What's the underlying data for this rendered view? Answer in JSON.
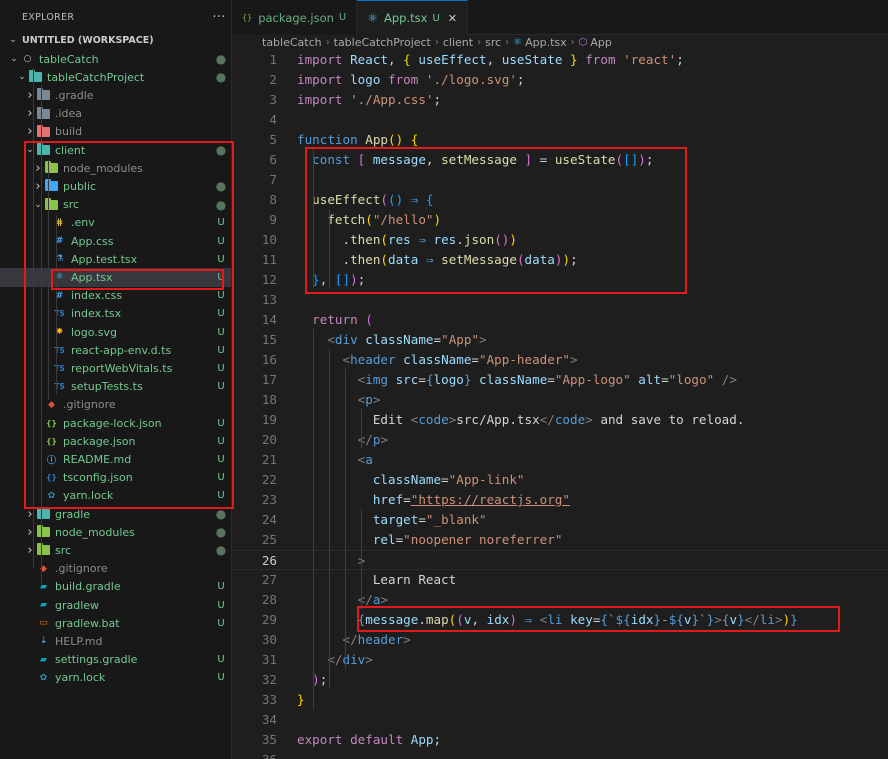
{
  "explorer": {
    "title": "EXPLORER",
    "more_label": "···",
    "workspace": "UNTITLED (WORKSPACE)",
    "items": [
      {
        "label": "tableCatch",
        "depth": 1,
        "chev": "v",
        "icon": "repo",
        "status": "dot",
        "cls": "c-git"
      },
      {
        "label": "tableCatchProject",
        "depth": 2,
        "chev": "v",
        "icon": "folder-teal",
        "status": "dot",
        "cls": "c-git"
      },
      {
        "label": ".gradle",
        "depth": 3,
        "chev": ">",
        "icon": "folder-gray",
        "status": "",
        "cls": "c-muted"
      },
      {
        "label": ".idea",
        "depth": 3,
        "chev": ">",
        "icon": "folder-gray",
        "status": "",
        "cls": "c-muted"
      },
      {
        "label": "build",
        "depth": 3,
        "chev": ">",
        "icon": "folder-red",
        "status": "",
        "cls": "c-muted"
      },
      {
        "label": "client",
        "depth": 3,
        "chev": "v",
        "icon": "folder-teal",
        "status": "dot",
        "cls": "c-git"
      },
      {
        "label": "node_modules",
        "depth": 4,
        "chev": ">",
        "icon": "folder-green",
        "status": "",
        "cls": "c-muted"
      },
      {
        "label": "public",
        "depth": 4,
        "chev": ">",
        "icon": "folder-blue",
        "status": "dot",
        "cls": "c-git"
      },
      {
        "label": "src",
        "depth": 4,
        "chev": "v",
        "icon": "folder-green",
        "status": "dot",
        "cls": "c-git"
      },
      {
        "label": ".env",
        "depth": 5,
        "chev": "",
        "icon": "env",
        "status": "U",
        "cls": "c-git"
      },
      {
        "label": "App.css",
        "depth": 5,
        "chev": "",
        "icon": "css",
        "status": "U",
        "cls": "c-git"
      },
      {
        "label": "App.test.tsx",
        "depth": 5,
        "chev": "",
        "icon": "test",
        "status": "U",
        "cls": "c-git"
      },
      {
        "label": "App.tsx",
        "depth": 5,
        "chev": "",
        "icon": "react",
        "status": "U",
        "cls": "c-git",
        "selected": true
      },
      {
        "label": "index.css",
        "depth": 5,
        "chev": "",
        "icon": "css",
        "status": "U",
        "cls": "c-git"
      },
      {
        "label": "index.tsx",
        "depth": 5,
        "chev": "",
        "icon": "ts",
        "status": "U",
        "cls": "c-git"
      },
      {
        "label": "logo.svg",
        "depth": 5,
        "chev": "",
        "icon": "svg",
        "status": "U",
        "cls": "c-git"
      },
      {
        "label": "react-app-env.d.ts",
        "depth": 5,
        "chev": "",
        "icon": "ts",
        "status": "U",
        "cls": "c-git"
      },
      {
        "label": "reportWebVitals.ts",
        "depth": 5,
        "chev": "",
        "icon": "ts",
        "status": "U",
        "cls": "c-git"
      },
      {
        "label": "setupTests.ts",
        "depth": 5,
        "chev": "",
        "icon": "ts",
        "status": "U",
        "cls": "c-git"
      },
      {
        "label": ".gitignore",
        "depth": 4,
        "chev": "",
        "icon": "git",
        "status": "",
        "cls": "c-muted"
      },
      {
        "label": "package-lock.json",
        "depth": 4,
        "chev": "",
        "icon": "json",
        "status": "U",
        "cls": "c-git"
      },
      {
        "label": "package.json",
        "depth": 4,
        "chev": "",
        "icon": "json",
        "status": "U",
        "cls": "c-git"
      },
      {
        "label": "README.md",
        "depth": 4,
        "chev": "",
        "icon": "info",
        "status": "U",
        "cls": "c-git"
      },
      {
        "label": "tsconfig.json",
        "depth": 4,
        "chev": "",
        "icon": "tsconfig",
        "status": "U",
        "cls": "c-git"
      },
      {
        "label": "yarn.lock",
        "depth": 4,
        "chev": "",
        "icon": "yarn",
        "status": "U",
        "cls": "c-git"
      },
      {
        "label": "gradle",
        "depth": 3,
        "chev": ">",
        "icon": "folder-teal",
        "status": "dot",
        "cls": "c-git"
      },
      {
        "label": "node_modules",
        "depth": 3,
        "chev": ">",
        "icon": "folder-green",
        "status": "dot",
        "cls": "c-git"
      },
      {
        "label": "src",
        "depth": 3,
        "chev": ">",
        "icon": "folder-green",
        "status": "dot",
        "cls": "c-git"
      },
      {
        "label": ".gitignore",
        "depth": 3,
        "chev": "",
        "icon": "git",
        "status": "",
        "cls": "c-muted"
      },
      {
        "label": "build.gradle",
        "depth": 3,
        "chev": "",
        "icon": "gradle",
        "status": "U",
        "cls": "c-git"
      },
      {
        "label": "gradlew",
        "depth": 3,
        "chev": "",
        "icon": "gradle",
        "status": "U",
        "cls": "c-git"
      },
      {
        "label": "gradlew.bat",
        "depth": 3,
        "chev": "",
        "icon": "bat",
        "status": "U",
        "cls": "c-git"
      },
      {
        "label": "HELP.md",
        "depth": 3,
        "chev": "",
        "icon": "md",
        "status": "",
        "cls": "c-muted"
      },
      {
        "label": "settings.gradle",
        "depth": 3,
        "chev": "",
        "icon": "gradle",
        "status": "U",
        "cls": "c-git"
      },
      {
        "label": "yarn.lock",
        "depth": 3,
        "chev": "",
        "icon": "yarn",
        "status": "U",
        "cls": "c-git"
      }
    ]
  },
  "tabs": [
    {
      "label": "package.json",
      "status": "U",
      "active": false,
      "icon": "json"
    },
    {
      "label": "App.tsx",
      "status": "U",
      "active": true,
      "icon": "react",
      "close": "✕"
    }
  ],
  "breadcrumb": [
    "tableCatch",
    "tableCatchProject",
    "client",
    "src",
    "App.tsx",
    "App"
  ],
  "colors": {
    "accent": "#0078d4",
    "git_untracked": "#73c991",
    "highlight_box": "#e11b1b"
  },
  "editor": {
    "current_line": 26,
    "lines": [
      [
        [
          "import ",
          "kw"
        ],
        [
          "React",
          "var"
        ],
        [
          ", ",
          "pn"
        ],
        [
          "{ ",
          "br1"
        ],
        [
          "useEffect",
          "var"
        ],
        [
          ", ",
          "pn"
        ],
        [
          "useState",
          "var"
        ],
        [
          " }",
          "br1"
        ],
        [
          " from ",
          "kw"
        ],
        [
          "'react'",
          "str"
        ],
        [
          ";",
          "pn"
        ]
      ],
      [
        [
          "import ",
          "kw"
        ],
        [
          "logo",
          "var"
        ],
        [
          " from ",
          "kw"
        ],
        [
          "'./logo.svg'",
          "str"
        ],
        [
          ";",
          "pn"
        ]
      ],
      [
        [
          "import ",
          "kw"
        ],
        [
          "'./App.css'",
          "str"
        ],
        [
          ";",
          "pn"
        ]
      ],
      [],
      [
        [
          "function ",
          "bl"
        ],
        [
          "App",
          "fn"
        ],
        [
          "() ",
          "br1"
        ],
        [
          "{",
          "br1"
        ]
      ],
      [
        [
          "  const ",
          "bl"
        ],
        [
          "[ ",
          "br2"
        ],
        [
          "message",
          "var"
        ],
        [
          ", ",
          "pn"
        ],
        [
          "setMessage",
          "fn"
        ],
        [
          " ]",
          "br2"
        ],
        [
          " = ",
          "pn"
        ],
        [
          "useState",
          "fn"
        ],
        [
          "(",
          "br2"
        ],
        [
          "[]",
          "br3"
        ],
        [
          ")",
          "br2"
        ],
        [
          ";",
          "pn"
        ]
      ],
      [],
      [
        [
          "  useEffect",
          "fn"
        ],
        [
          "(",
          "br2"
        ],
        [
          "() ",
          "br3"
        ],
        [
          "⇒ ",
          "bl"
        ],
        [
          "{",
          "br3"
        ]
      ],
      [
        [
          "    fetch",
          "fn"
        ],
        [
          "(",
          "br1"
        ],
        [
          "\"/hello\"",
          "str"
        ],
        [
          ")",
          "br1"
        ]
      ],
      [
        [
          "      .",
          "pn"
        ],
        [
          "then",
          "fn"
        ],
        [
          "(",
          "br1"
        ],
        [
          "res",
          "var"
        ],
        [
          " ⇒ ",
          "bl"
        ],
        [
          "res",
          "var"
        ],
        [
          ".",
          "pn"
        ],
        [
          "json",
          "fn"
        ],
        [
          "()",
          "br2"
        ],
        [
          ")",
          "br1"
        ]
      ],
      [
        [
          "      .",
          "pn"
        ],
        [
          "then",
          "fn"
        ],
        [
          "(",
          "br1"
        ],
        [
          "data",
          "var"
        ],
        [
          " ⇒ ",
          "bl"
        ],
        [
          "setMessage",
          "fn"
        ],
        [
          "(",
          "br2"
        ],
        [
          "data",
          "var"
        ],
        [
          ")",
          "br2"
        ],
        [
          ")",
          "br1"
        ],
        [
          ";",
          "pn"
        ]
      ],
      [
        [
          "  }",
          "br3"
        ],
        [
          ", ",
          "pn"
        ],
        [
          "[]",
          "br3"
        ],
        [
          ")",
          "br2"
        ],
        [
          ";",
          "pn"
        ]
      ],
      [],
      [
        [
          "  return ",
          "kw"
        ],
        [
          "(",
          "br2"
        ]
      ],
      [
        [
          "    <",
          "tagb"
        ],
        [
          "div ",
          "tag"
        ],
        [
          "className",
          "attr"
        ],
        [
          "=",
          "pn"
        ],
        [
          "\"App\"",
          "str"
        ],
        [
          ">",
          "tagb"
        ]
      ],
      [
        [
          "      <",
          "tagb"
        ],
        [
          "header ",
          "tag"
        ],
        [
          "className",
          "attr"
        ],
        [
          "=",
          "pn"
        ],
        [
          "\"App-header\"",
          "str"
        ],
        [
          ">",
          "tagb"
        ]
      ],
      [
        [
          "        <",
          "tagb"
        ],
        [
          "img ",
          "tag"
        ],
        [
          "src",
          "attr"
        ],
        [
          "=",
          "pn"
        ],
        [
          "{",
          "bl"
        ],
        [
          "logo",
          "var"
        ],
        [
          "}",
          "bl"
        ],
        [
          " className",
          "attr"
        ],
        [
          "=",
          "pn"
        ],
        [
          "\"App-logo\"",
          "str"
        ],
        [
          " alt",
          "attr"
        ],
        [
          "=",
          "pn"
        ],
        [
          "\"logo\"",
          "str"
        ],
        [
          " />",
          "tagb"
        ]
      ],
      [
        [
          "        <",
          "tagb"
        ],
        [
          "p",
          "tag"
        ],
        [
          ">",
          "tagb"
        ]
      ],
      [
        [
          "          Edit ",
          "pn"
        ],
        [
          "<",
          "tagb"
        ],
        [
          "code",
          "tag"
        ],
        [
          ">",
          "tagb"
        ],
        [
          "src/App.tsx",
          "pn"
        ],
        [
          "</",
          "tagb"
        ],
        [
          "code",
          "tag"
        ],
        [
          ">",
          "tagb"
        ],
        [
          " and save to reload.",
          "pn"
        ]
      ],
      [
        [
          "        </",
          "tagb"
        ],
        [
          "p",
          "tag"
        ],
        [
          ">",
          "tagb"
        ]
      ],
      [
        [
          "        <",
          "tagb"
        ],
        [
          "a",
          "tag"
        ]
      ],
      [
        [
          "          className",
          "attr"
        ],
        [
          "=",
          "pn"
        ],
        [
          "\"App-link\"",
          "str"
        ]
      ],
      [
        [
          "          href",
          "attr"
        ],
        [
          "=",
          "pn"
        ],
        [
          "\"https://reactjs.org\"",
          "str url"
        ]
      ],
      [
        [
          "          target",
          "attr"
        ],
        [
          "=",
          "pn"
        ],
        [
          "\"_blank\"",
          "str"
        ]
      ],
      [
        [
          "          rel",
          "attr"
        ],
        [
          "=",
          "pn"
        ],
        [
          "\"noopener noreferrer\"",
          "str"
        ]
      ],
      [
        [
          "        >",
          "tagb"
        ]
      ],
      [
        [
          "          Learn React",
          "pn"
        ]
      ],
      [
        [
          "        </",
          "tagb"
        ],
        [
          "a",
          "tag"
        ],
        [
          ">",
          "tagb"
        ]
      ],
      [
        [
          "        {",
          "bl"
        ],
        [
          "message",
          "var"
        ],
        [
          ".",
          "pn"
        ],
        [
          "map",
          "fn"
        ],
        [
          "(",
          "br1"
        ],
        [
          "(",
          "br2"
        ],
        [
          "v",
          "var"
        ],
        [
          ", ",
          "pn"
        ],
        [
          "idx",
          "var"
        ],
        [
          ")",
          "br2"
        ],
        [
          " ⇒ ",
          "bl"
        ],
        [
          "<",
          "tagb"
        ],
        [
          "li ",
          "tag"
        ],
        [
          "key",
          "attr"
        ],
        [
          "=",
          "pn"
        ],
        [
          "{",
          "bl"
        ],
        [
          "`",
          "str"
        ],
        [
          "${",
          "bl"
        ],
        [
          "idx",
          "var"
        ],
        [
          "}",
          "bl"
        ],
        [
          "-",
          "str"
        ],
        [
          "${",
          "bl"
        ],
        [
          "v",
          "var"
        ],
        [
          "}",
          "bl"
        ],
        [
          "`",
          "str"
        ],
        [
          "}",
          "bl"
        ],
        [
          ">",
          "tagb"
        ],
        [
          "{",
          "bl"
        ],
        [
          "v",
          "var"
        ],
        [
          "}",
          "bl"
        ],
        [
          "</",
          "tagb"
        ],
        [
          "li",
          "tag"
        ],
        [
          ">",
          "tagb"
        ],
        [
          ")",
          "br1"
        ],
        [
          "}",
          "bl"
        ]
      ],
      [
        [
          "      </",
          "tagb"
        ],
        [
          "header",
          "tag"
        ],
        [
          ">",
          "tagb"
        ]
      ],
      [
        [
          "    </",
          "tagb"
        ],
        [
          "div",
          "tag"
        ],
        [
          ">",
          "tagb"
        ]
      ],
      [
        [
          "  )",
          "br2"
        ],
        [
          ";",
          "pn"
        ]
      ],
      [
        [
          "}",
          "br1"
        ]
      ],
      [],
      [
        [
          "export ",
          "kw"
        ],
        [
          "default ",
          "kw"
        ],
        [
          "App",
          "var"
        ],
        [
          ";",
          "pn"
        ]
      ],
      []
    ]
  }
}
